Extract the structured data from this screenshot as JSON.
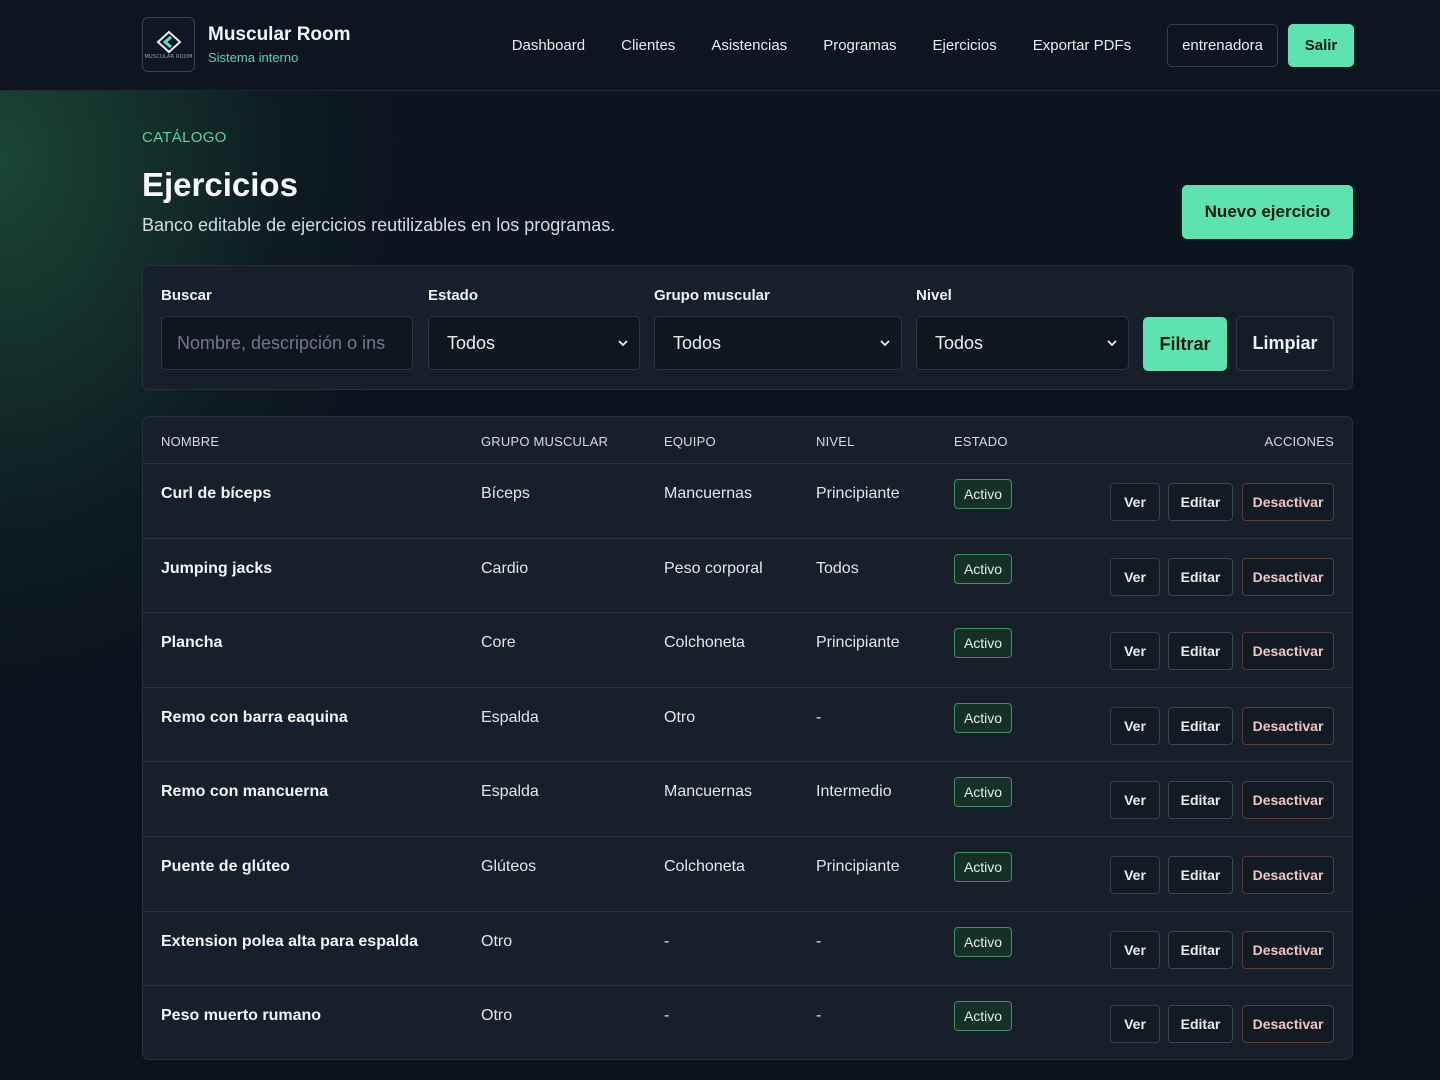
{
  "brand": {
    "logo_text": "MUSCULAR ROOM",
    "name": "Muscular Room",
    "subtitle": "Sistema interno"
  },
  "nav": {
    "links": [
      "Dashboard",
      "Clientes",
      "Asistencias",
      "Programas",
      "Ejercicios",
      "Exportar PDFs"
    ],
    "user": "entrenadora",
    "logout": "Salir"
  },
  "header": {
    "eyebrow": "CATÁLOGO",
    "title": "Ejercicios",
    "description": "Banco editable de ejercicios reutilizables en los programas.",
    "new_button": "Nuevo ejercicio"
  },
  "filters": {
    "search_label": "Buscar",
    "search_placeholder": "Nombre, descripción o ins",
    "estado_label": "Estado",
    "estado_value": "Todos",
    "grupo_label": "Grupo muscular",
    "grupo_value": "Todos",
    "nivel_label": "Nivel",
    "nivel_value": "Todos",
    "filter_button": "Filtrar",
    "clear_button": "Limpiar"
  },
  "table": {
    "headers": [
      "NOMBRE",
      "GRUPO MUSCULAR",
      "EQUIPO",
      "NIVEL",
      "ESTADO",
      "ACCIONES"
    ],
    "action_labels": {
      "view": "Ver",
      "edit": "Editar",
      "deactivate": "Desactivar"
    },
    "rows": [
      {
        "name": "Curl de bíceps",
        "group": "Bíceps",
        "equipment": "Mancuernas",
        "level": "Principiante",
        "status": "Activo"
      },
      {
        "name": "Jumping jacks",
        "group": "Cardio",
        "equipment": "Peso corporal",
        "level": "Todos",
        "status": "Activo"
      },
      {
        "name": "Plancha",
        "group": "Core",
        "equipment": "Colchoneta",
        "level": "Principiante",
        "status": "Activo"
      },
      {
        "name": "Remo con barra eaquina",
        "group": "Espalda",
        "equipment": "Otro",
        "level": "-",
        "status": "Activo"
      },
      {
        "name": "Remo con mancuerna",
        "group": "Espalda",
        "equipment": "Mancuernas",
        "level": "Intermedio",
        "status": "Activo"
      },
      {
        "name": "Puente de glúteo",
        "group": "Glúteos",
        "equipment": "Colchoneta",
        "level": "Principiante",
        "status": "Activo"
      },
      {
        "name": "Extension polea alta para espalda",
        "group": "Otro",
        "equipment": "-",
        "level": "-",
        "status": "Activo"
      },
      {
        "name": "Peso muerto rumano",
        "group": "Otro",
        "equipment": "-",
        "level": "-",
        "status": "Activo"
      }
    ]
  },
  "colors": {
    "accent": "#5de3b0",
    "background": "#0b131d",
    "card": "#161f2a",
    "badge_border": "#3f8f6a"
  }
}
